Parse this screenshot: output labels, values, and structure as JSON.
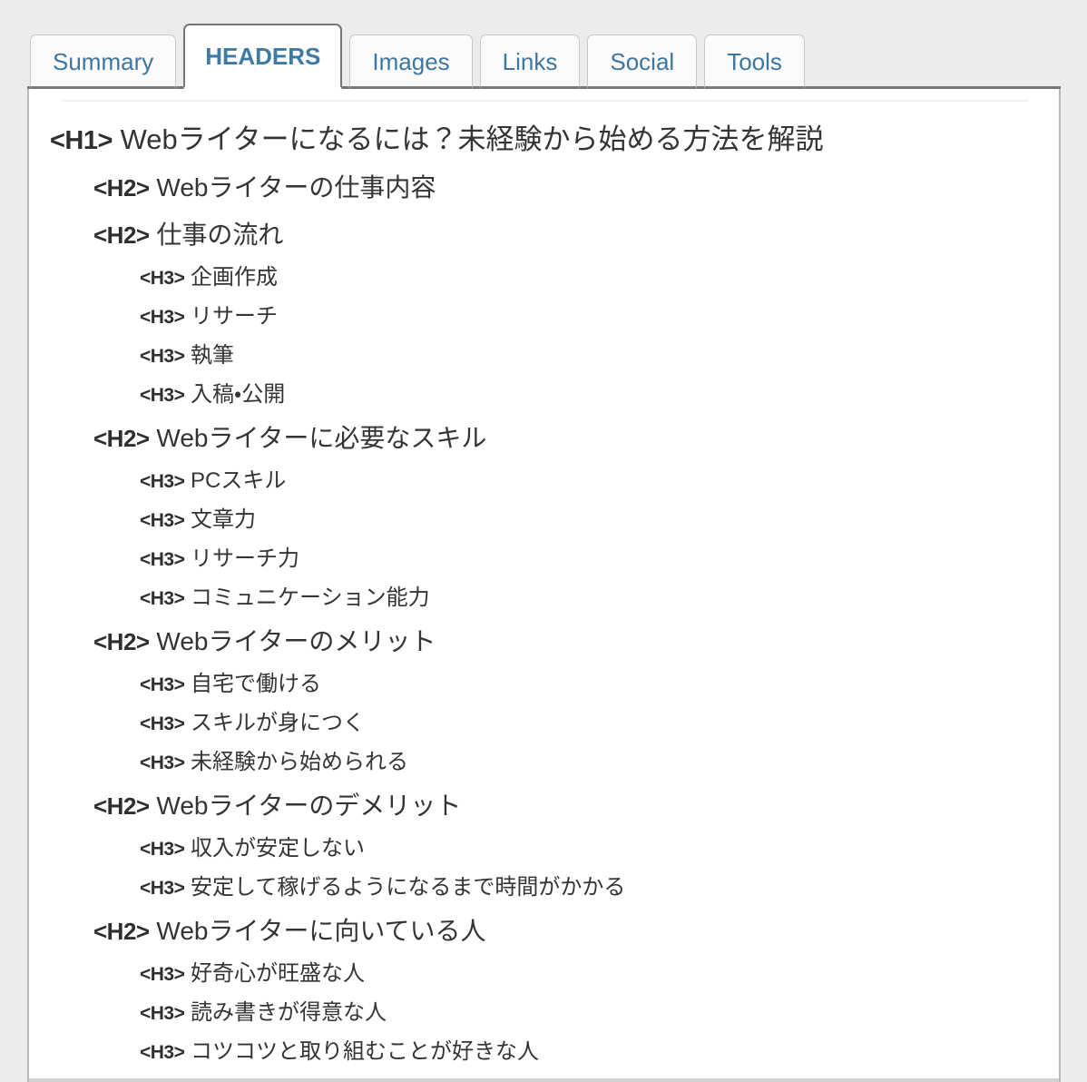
{
  "tabs": [
    {
      "label": "Summary",
      "active": false
    },
    {
      "label": "HEADERS",
      "active": true
    },
    {
      "label": "Images",
      "active": false
    },
    {
      "label": "Links",
      "active": false
    },
    {
      "label": "Social",
      "active": false
    },
    {
      "label": "Tools",
      "active": false
    }
  ],
  "colors": {
    "tab_text": "#3d76a0",
    "tab_active_text": "#3d7aa4",
    "page_background": "#ececec",
    "panel_background": "#ffffff",
    "heading_text": "#343434",
    "tab_border": "#777777"
  },
  "headers": [
    {
      "tag": "<H1>",
      "level": 1,
      "text": "Webライターになるには？未経験から始める方法を解説"
    },
    {
      "tag": "<H2>",
      "level": 2,
      "text": "Webライターの仕事内容"
    },
    {
      "tag": "<H2>",
      "level": 2,
      "text": "仕事の流れ"
    },
    {
      "tag": "<H3>",
      "level": 3,
      "text": "企画作成"
    },
    {
      "tag": "<H3>",
      "level": 3,
      "text": "リサーチ"
    },
    {
      "tag": "<H3>",
      "level": 3,
      "text": "執筆"
    },
    {
      "tag": "<H3>",
      "level": 3,
      "text": "入稿・公開"
    },
    {
      "tag": "<H2>",
      "level": 2,
      "text": "Webライターに必要なスキル"
    },
    {
      "tag": "<H3>",
      "level": 3,
      "text": "PCスキル"
    },
    {
      "tag": "<H3>",
      "level": 3,
      "text": "文章力"
    },
    {
      "tag": "<H3>",
      "level": 3,
      "text": "リサーチ力"
    },
    {
      "tag": "<H3>",
      "level": 3,
      "text": "コミュニケーション能力"
    },
    {
      "tag": "<H2>",
      "level": 2,
      "text": "Webライターのメリット"
    },
    {
      "tag": "<H3>",
      "level": 3,
      "text": "自宅で働ける"
    },
    {
      "tag": "<H3>",
      "level": 3,
      "text": "スキルが身につく"
    },
    {
      "tag": "<H3>",
      "level": 3,
      "text": "未経験から始められる"
    },
    {
      "tag": "<H2>",
      "level": 2,
      "text": "Webライターのデメリット"
    },
    {
      "tag": "<H3>",
      "level": 3,
      "text": "収入が安定しない"
    },
    {
      "tag": "<H3>",
      "level": 3,
      "text": "安定して稼げるようになるまで時間がかかる"
    },
    {
      "tag": "<H2>",
      "level": 2,
      "text": "Webライターに向いている人"
    },
    {
      "tag": "<H3>",
      "level": 3,
      "text": "好奇心が旺盛な人"
    },
    {
      "tag": "<H3>",
      "level": 3,
      "text": "読み書きが得意な人"
    },
    {
      "tag": "<H3>",
      "level": 3,
      "text": "コツコツと取り組むことが好きな人"
    }
  ]
}
